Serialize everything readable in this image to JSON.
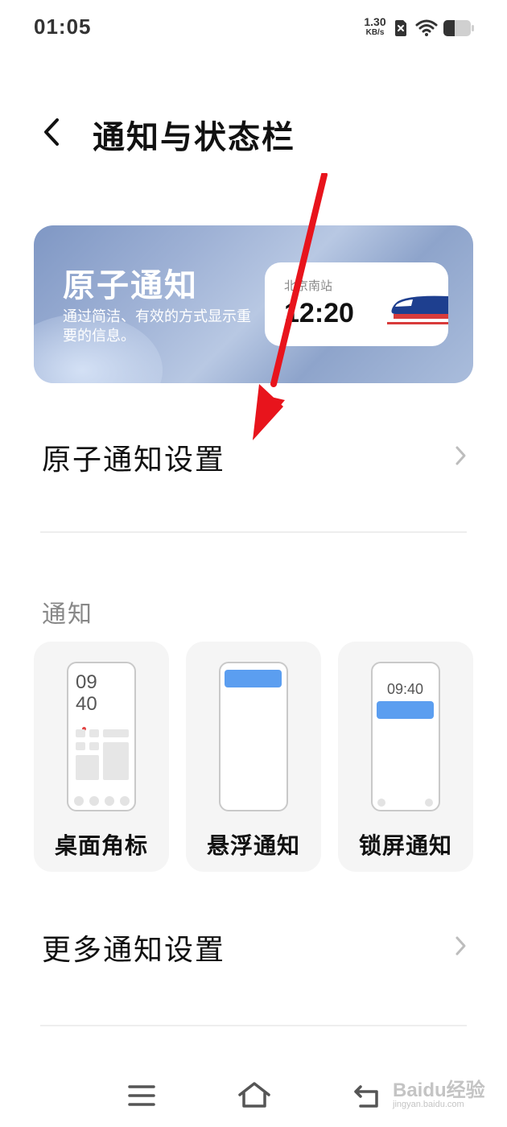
{
  "status_bar": {
    "time": "01:05",
    "net_speed_value": "1.30",
    "net_speed_unit": "KB/s",
    "icons": [
      "sim-off-icon",
      "wifi-icon",
      "battery-icon"
    ]
  },
  "header": {
    "title": "通知与状态栏",
    "back_icon": "chevron-left-icon"
  },
  "banner": {
    "title": "原子通知",
    "description": "通过简洁、有效的方式显示重要的信息。",
    "ticket": {
      "station": "北京南站",
      "time": "12:20",
      "icon": "train-icon"
    }
  },
  "atomic_settings_row": {
    "label": "原子通知设置",
    "icon": "chevron-right-icon"
  },
  "notifications_section": {
    "title": "通知",
    "cards": [
      {
        "label": "桌面角标",
        "preview_time": "09 40"
      },
      {
        "label": "悬浮通知"
      },
      {
        "label": "锁屏通知",
        "preview_time": "09:40"
      }
    ]
  },
  "more_settings_row": {
    "label": "更多通知设置",
    "icon": "chevron-right-icon"
  },
  "nav_bar": {
    "icons": [
      "menu-icon",
      "home-icon",
      "back-icon"
    ]
  },
  "watermark": {
    "main": "Baidu经验",
    "sub": "jingyan.baidu.com"
  },
  "colors": {
    "accent_blue": "#5b9ef0",
    "annotation_red": "#e8141c",
    "badge_red": "#e34444"
  }
}
